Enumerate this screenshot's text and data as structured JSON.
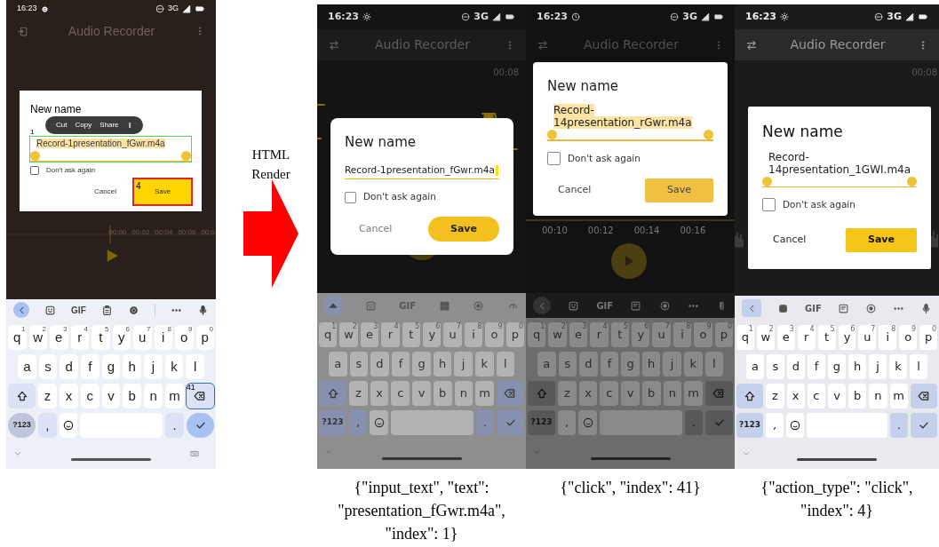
{
  "render_label": "HTML Render",
  "screens": [
    {
      "kind": "original",
      "status": {
        "time": "16:23",
        "network": "3G"
      },
      "app_title": "Audio Recorder",
      "timeline": [
        "00:00",
        "00:02",
        "00:04",
        "00:06",
        "00:0"
      ],
      "dialog": {
        "title": "New name",
        "field": {
          "value": "Record-1presentation_fGwr.m4a",
          "text_selected": true,
          "handles": true,
          "cursor": false,
          "marker": "1"
        },
        "context_menu": [
          "Cut",
          "Copy",
          "Share"
        ],
        "checkbox": {
          "label": "Don't ask again",
          "checked": false
        },
        "cancel": "Cancel",
        "save": {
          "label": "Save",
          "marker": "4"
        }
      },
      "keyboard": {
        "gif": "GIF",
        "rows": [
          [
            "q",
            "w",
            "e",
            "r",
            "t",
            "y",
            "u",
            "i",
            "o",
            "p"
          ],
          [
            "a",
            "s",
            "d",
            "f",
            "g",
            "h",
            "j",
            "k",
            "l"
          ],
          [
            "z",
            "x",
            "c",
            "v",
            "b",
            "n",
            "m"
          ]
        ],
        "hints": [
          "1",
          "2",
          "3",
          "4",
          "5",
          "6",
          "7",
          "8",
          "9",
          "0"
        ],
        "symbols": "?123",
        "comma": ",",
        "period": ".",
        "backspace_marker": "41"
      }
    },
    {
      "kind": "grey",
      "status": {
        "time": "16:23",
        "network": "3G"
      },
      "app_title": "Audio Recorder",
      "timeline": [
        "00:08"
      ],
      "dialog": {
        "title": "New name",
        "field": {
          "value": "Record-1presentation_fGwr.m4a",
          "text_selected": false,
          "handles": false,
          "cursor": true
        },
        "checkbox": {
          "label": "Don't ask again",
          "checked": false
        },
        "cancel": "Cancel",
        "save": {
          "label": "Save"
        }
      },
      "keyboard": {
        "gif": "GIF",
        "rows": [
          [
            "q",
            "w",
            "e",
            "r",
            "t",
            "y",
            "u",
            "i",
            "o",
            "p"
          ],
          [
            "a",
            "s",
            "d",
            "f",
            "g",
            "h",
            "j",
            "k",
            "l"
          ],
          [
            "z",
            "x",
            "c",
            "v",
            "b",
            "n",
            "m"
          ]
        ],
        "hints": [
          "1",
          "2",
          "3",
          "4",
          "5",
          "6",
          "7",
          "8",
          "9",
          "0"
        ],
        "symbols": "?123",
        "comma": ",",
        "period": "."
      },
      "caption": "{\"input_text\", \"text\": \"presentation_fGwr.m4a\", \"index\": 1}"
    },
    {
      "kind": "dark",
      "status": {
        "time": "16:23",
        "network": "3G"
      },
      "app_title": "Audio Recorder",
      "timeline": [
        "00:10",
        "00:12",
        "00:14",
        "00:16"
      ],
      "dialog": {
        "title": "New name",
        "field": {
          "value": "Record-14presentation_rGwr.m4a",
          "text_selected": true,
          "handles": true,
          "cursor": false
        },
        "checkbox": {
          "label": "Don't ask again",
          "checked": false
        },
        "cancel": "Cancel",
        "save": {
          "label": "Save"
        }
      },
      "keyboard": {
        "gif": "GIF",
        "rows": [
          [
            "q",
            "w",
            "e",
            "r",
            "t",
            "y",
            "u",
            "i",
            "o",
            "p"
          ],
          [
            "a",
            "s",
            "d",
            "f",
            "g",
            "h",
            "j",
            "k",
            "l"
          ],
          [
            "z",
            "x",
            "c",
            "v",
            "b",
            "n",
            "m"
          ]
        ],
        "hints": [
          "1",
          "2",
          "3",
          "4",
          "5",
          "6",
          "7",
          "8",
          "9",
          "0"
        ],
        "symbols": "?123",
        "comma": ",",
        "period": "."
      },
      "caption": "{\"click\", \"index\": 41}"
    },
    {
      "kind": "light",
      "status": {
        "time": "16:23",
        "network": "3G"
      },
      "app_title": "Audio Recorder",
      "timeline": [
        "00:08"
      ],
      "dialog": {
        "title": "New name",
        "field": {
          "value": "Record-14presentation_1GWI.m4a",
          "text_selected": false,
          "handles": true,
          "cursor": false
        },
        "checkbox": {
          "label": "Don't ask again",
          "checked": false
        },
        "cancel": "Cancel",
        "save": {
          "label": "Save"
        }
      },
      "keyboard": {
        "gif": "GIF",
        "rows": [
          [
            "q",
            "w",
            "e",
            "r",
            "t",
            "y",
            "u",
            "i",
            "o",
            "p"
          ],
          [
            "a",
            "s",
            "d",
            "f",
            "g",
            "h",
            "j",
            "k",
            "l"
          ],
          [
            "z",
            "x",
            "c",
            "v",
            "b",
            "n",
            "m"
          ]
        ],
        "hints": [
          "1",
          "2",
          "3",
          "4",
          "5",
          "6",
          "7",
          "8",
          "9",
          "0"
        ],
        "symbols": "?123",
        "comma": ",",
        "period": "."
      },
      "caption": "{\"action_type\": \"click\", \"index\": 4}"
    }
  ]
}
